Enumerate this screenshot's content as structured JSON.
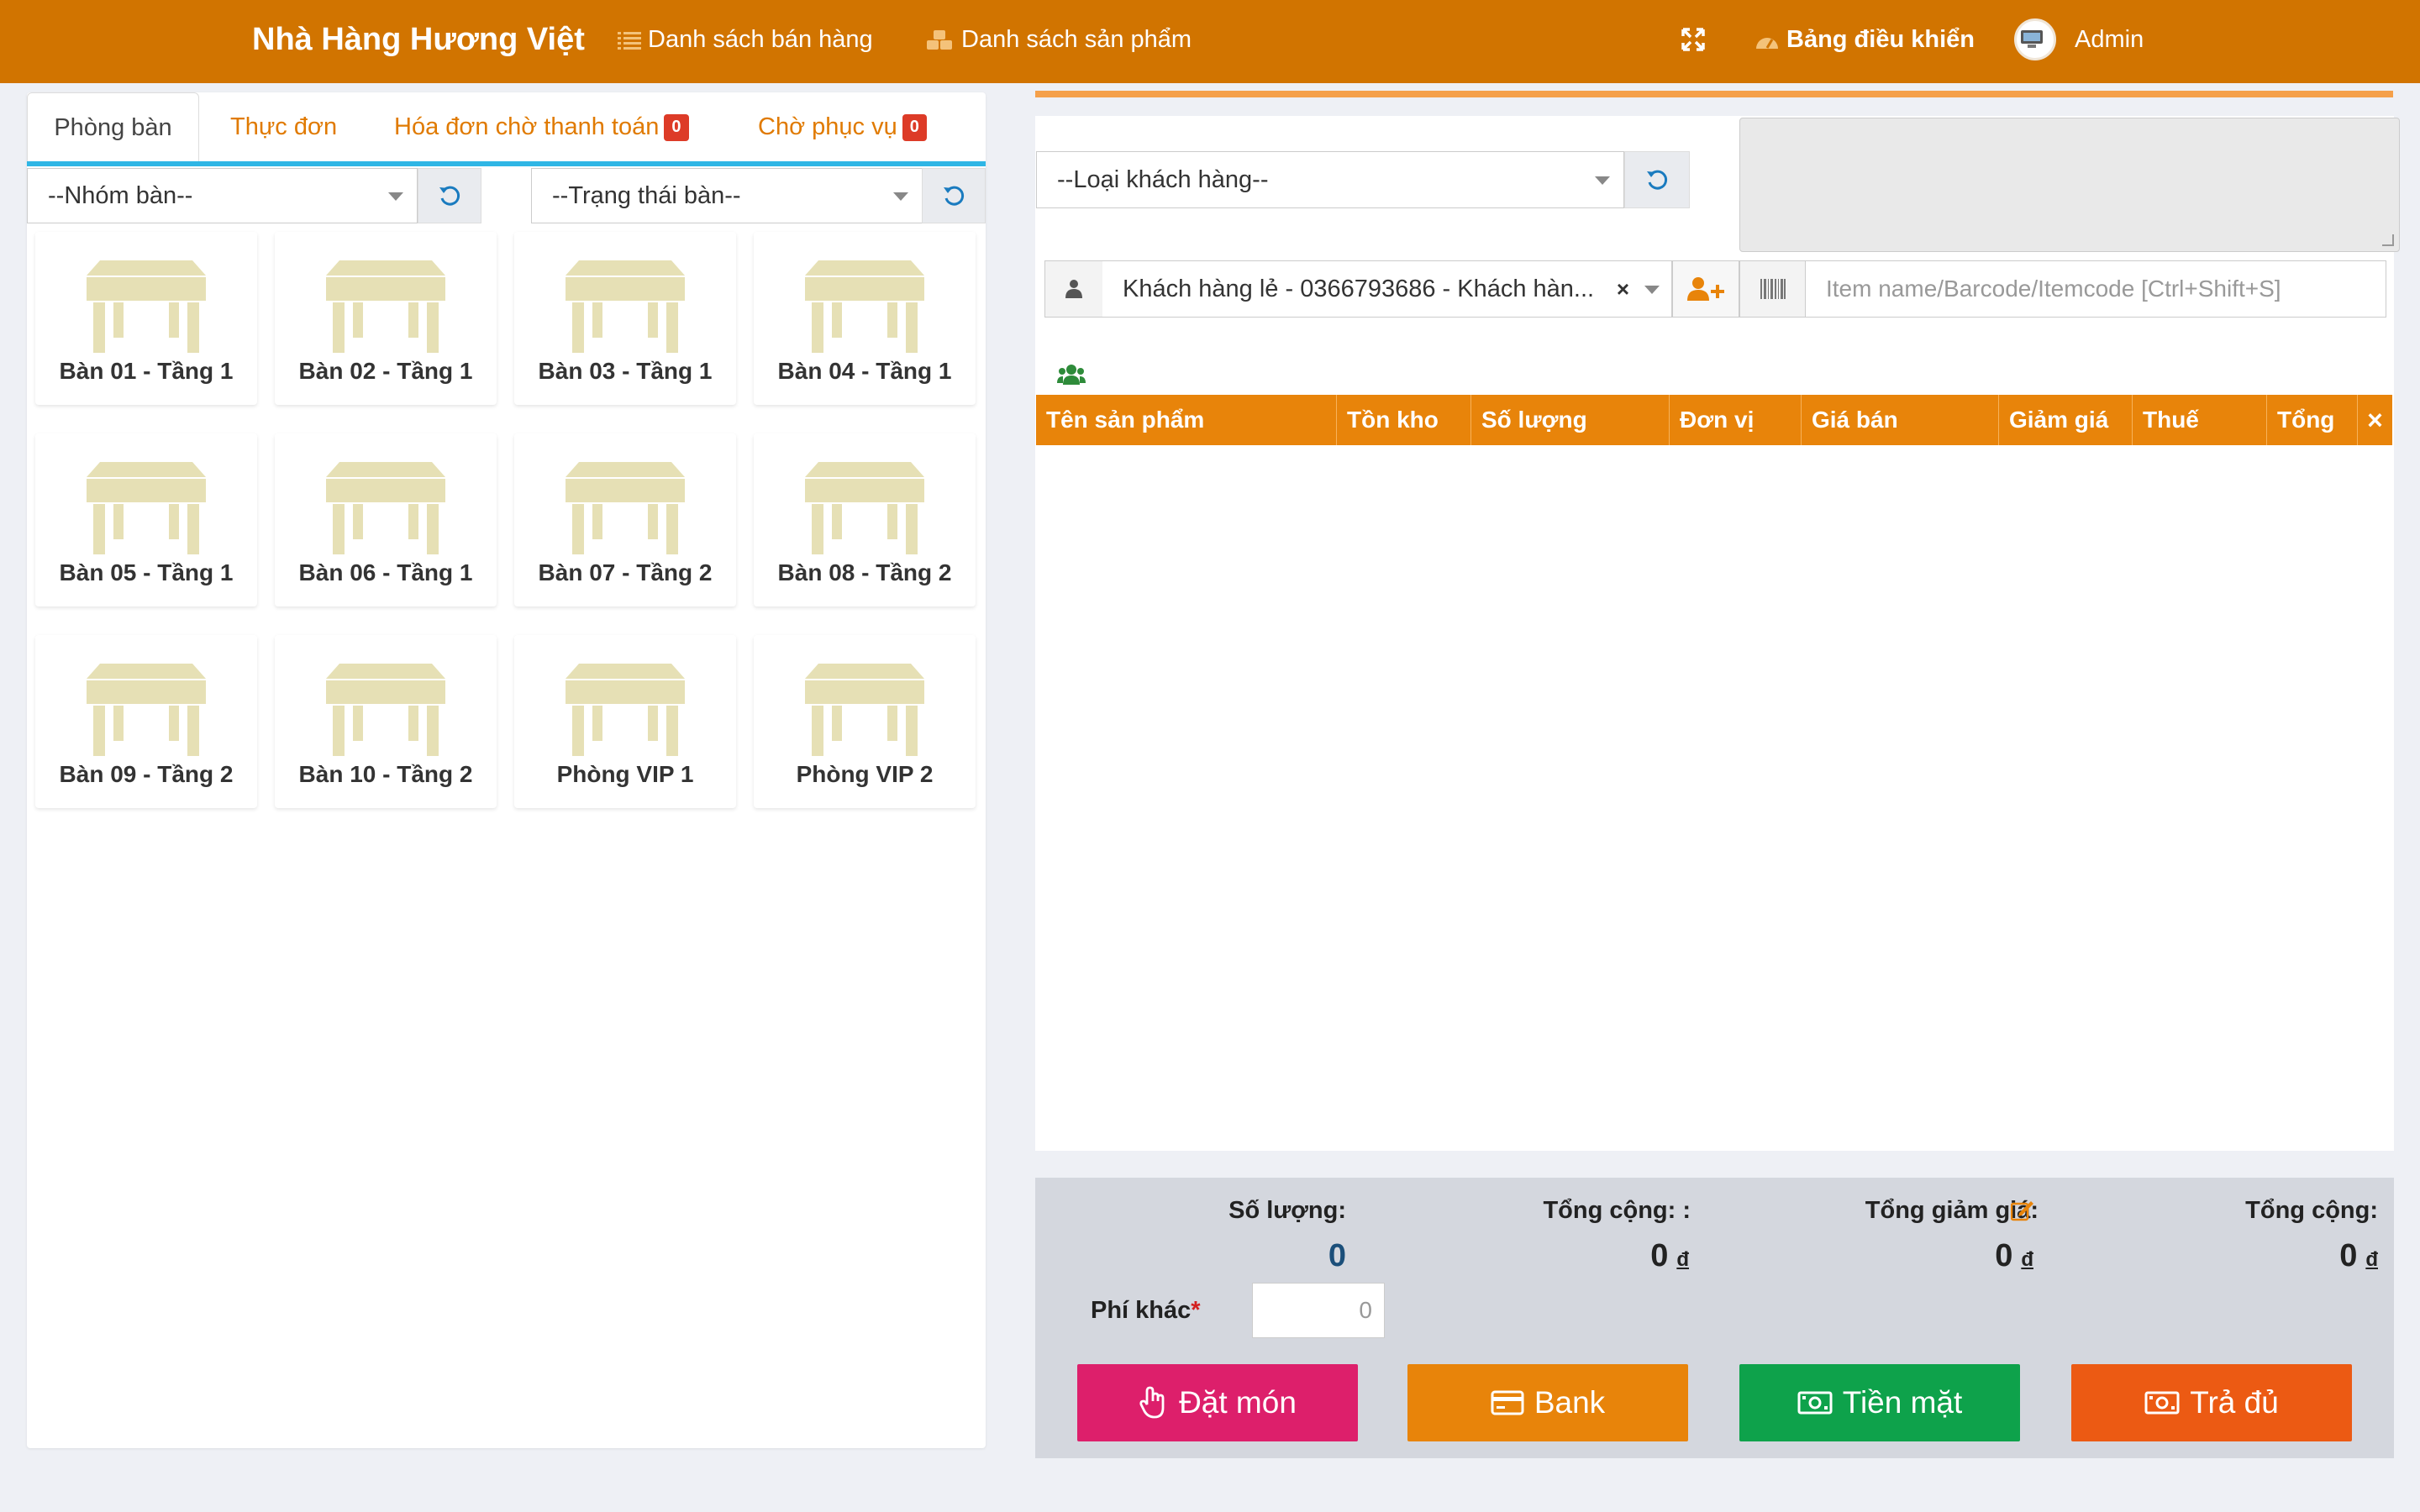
{
  "header": {
    "brand": "Nhà Hàng Hương Việt",
    "nav_sales": "Danh sách bán hàng",
    "nav_products": "Danh sách sản phẩm",
    "nav_dashboard": "Bảng điều khiển",
    "user": "Admin"
  },
  "left": {
    "tabs": {
      "tables": "Phòng bàn",
      "menu": "Thực đơn",
      "pending": "Hóa đơn chờ thanh toán",
      "pending_count": "0",
      "serving": "Chờ phục vụ",
      "serving_count": "0"
    },
    "filters": {
      "group": "--Nhóm bàn--",
      "status": "--Trạng thái bàn--"
    },
    "tables": [
      "Bàn 01 - Tầng 1",
      "Bàn 02 - Tầng 1",
      "Bàn 03 - Tầng 1",
      "Bàn 04 - Tầng 1",
      "Bàn 05 - Tầng 1",
      "Bàn 06 - Tầng 1",
      "Bàn 07 - Tầng 2",
      "Bàn 08 - Tầng 2",
      "Bàn 09 - Tầng 2",
      "Bàn 10 - Tầng 2",
      "Phòng VIP 1",
      "Phòng VIP 2"
    ]
  },
  "right": {
    "customer_type": "--Loại khách hàng--",
    "customer": "Khách hàng lẻ - 0366793686 - Khách hàn...",
    "search_placeholder": "Item name/Barcode/Itemcode [Ctrl+Shift+S]",
    "columns": [
      "Tên sản phẩm",
      "Tồn kho",
      "Số lượng",
      "Đơn vị",
      "Giá bán",
      "Giảm giá",
      "Thuế",
      "Tổng"
    ],
    "remove_all": "×"
  },
  "totals": {
    "qty_label": "Số lượng:",
    "qty_value": "0",
    "subtotal_label": "Tổng cộng: :",
    "subtotal_value": "0",
    "discount_label": "Tổng giảm giá:",
    "discount_value": "0",
    "total_label": "Tổng cộng:",
    "total_value": "0",
    "currency": "đ",
    "fee_label": "Phí khác",
    "fee_required": "*",
    "fee_value": "0"
  },
  "actions": {
    "order": "Đặt món",
    "bank": "Bank",
    "cash": "Tiền mặt",
    "full": "Trả đủ"
  },
  "colors": {
    "header": "#d17400",
    "grid_header": "#e8840a",
    "tab_accent": "#2fb6e5",
    "order": "#dd1f6b",
    "bank": "#e8840a",
    "cash": "#0ea24b",
    "full": "#ec5a13",
    "table_icon": "#e6e0b5"
  }
}
